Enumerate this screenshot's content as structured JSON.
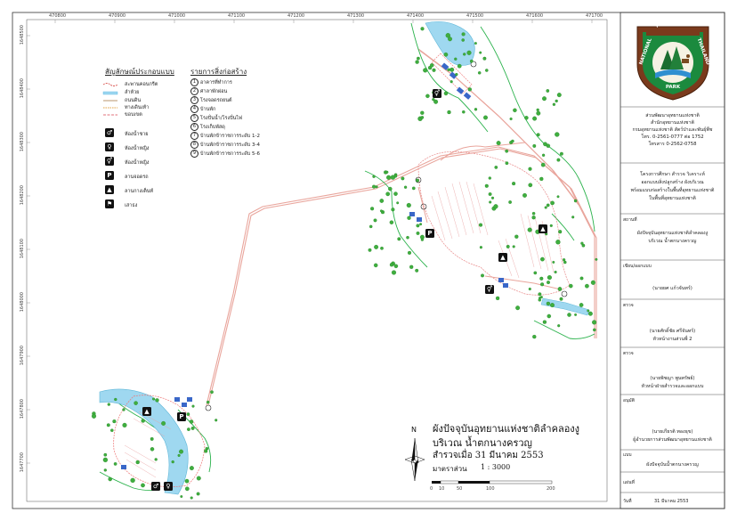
{
  "grid": {
    "top_ticks": [
      "470800",
      "470900",
      "471000",
      "471100",
      "471200",
      "471300",
      "471400",
      "471500",
      "471600",
      "471700"
    ],
    "left_ticks": [
      "1648500",
      "1648400",
      "1648300",
      "1648200",
      "1648100",
      "1648000",
      "1647900",
      "1647800",
      "1647700"
    ]
  },
  "legend": {
    "symbols_title": "สัญลักษณ์ประกอบแบบ",
    "lines": [
      {
        "label": "สะพานคอนกรีต",
        "color": "#d9534f"
      },
      {
        "label": "ลำห้วย",
        "color": "#4fb3e0"
      },
      {
        "label": "ถนนดิน",
        "color": "#b38b5d"
      },
      {
        "label": "ทางเดินเท้า",
        "color": "#e0a040"
      },
      {
        "label": "ขอบเขต",
        "color": "#e0707a"
      }
    ],
    "icons": [
      {
        "label": "ห้องน้ำชาย",
        "icon": "male-restroom-icon",
        "glyph": "♂"
      },
      {
        "label": "ห้องน้ำหญิง",
        "icon": "female-restroom-icon",
        "glyph": "♀"
      },
      {
        "label": "ห้องน้ำหญิง",
        "icon": "restroom-icon",
        "glyph": "⚥"
      },
      {
        "label": "ลานจอดรถ",
        "icon": "parking-icon",
        "glyph": "P"
      },
      {
        "label": "ลานกางเต็นท์",
        "icon": "camping-icon",
        "glyph": "▲"
      },
      {
        "label": "เสาธง",
        "icon": "flagpole-icon",
        "glyph": "⚑"
      }
    ],
    "facilities_title": "รายการสิ่งก่อสร้าง",
    "facilities": [
      {
        "num": "1",
        "label": "อาคารที่ทำการ"
      },
      {
        "num": "2",
        "label": "ศาลาพักผ่อน"
      },
      {
        "num": "3",
        "label": "โรงจอดรถยนต์"
      },
      {
        "num": "4",
        "label": "บ้านพัก"
      },
      {
        "num": "5",
        "label": "โรงปั่นน้ำ/โรงปั่นไฟ"
      },
      {
        "num": "6",
        "label": "โรงเก็บพัสดุ"
      },
      {
        "num": "7",
        "label": "บ้านพักข้าราชการระดับ 1-2"
      },
      {
        "num": "8",
        "label": "บ้านพักข้าราชการระดับ 3-4"
      },
      {
        "num": "9",
        "label": "บ้านพักข้าราชการระดับ 5-6"
      }
    ]
  },
  "plan": {
    "title": "ผังปัจจุบันอุทยานแห่งชาติลำคลองงู",
    "subtitle": "บริเวณ น้ำตกนางครวญ",
    "survey_date": "สำรวจเมื่อ 31 มีนาคม 2553",
    "scale_label": "มาตราส่วน",
    "scale_value": "1 : 3000",
    "north": "N",
    "scale_ticks": [
      "0",
      "10",
      "50",
      "100",
      "200"
    ]
  },
  "title_block": {
    "logo_top_text": "อุทยานแห่งชาติ",
    "logo_left_text": "NATIONAL",
    "logo_right_text": "THAILAND",
    "logo_bottom_text": "PARK",
    "org_lines": [
      "ส่วนพัฒนาอุทยานแห่งชาติ",
      "สำนักอุทยานแห่งชาติ",
      "กรมอุทยานแห่งชาติ สัตว์ป่าและพันธุ์พืช",
      "โทร. 0-2561-0777 ต่อ 1752",
      "โทรสาร 0-2562-0758"
    ],
    "project_lines": [
      "โครงการศึกษา สำรวจ วิเคราะห์",
      "ออกแบบสิ่งปลูกสร้าง ผังบริเวณ",
      "พร้อมแบบก่อสร้างในพื้นที่อุทยานแห่งชาติ",
      "ในพื้นที่อุทยานแห่งชาติ"
    ],
    "sheet_label": "สถานที่",
    "sheet_lines": [
      "ผังปัจจุบันอุทยานแห่งชาติลำคลองงู",
      "บริเวณ น้ำตกนางครวญ"
    ],
    "designer_label": "เขียน/ออกแบบ",
    "designer_name": "(นายยศ แก้วจันทร์)",
    "check1_label": "ตรวจ",
    "check1_name": "(นายศักดิ์ชัย ศรีจันทร์)",
    "check1_title": "หัวหน้างานส่วนพี่ 2",
    "check2_label": "ตรวจ",
    "check2_name": "(นายพิชญา พูนทรัพย์)",
    "check2_title": "หัวหน้าฝ่ายสำรวจและออกแบบ",
    "approve_label": "อนุมัติ",
    "approve_name": "(นายเกียรติ ทองธุข)",
    "approve_title": "ผู้อำนวยการส่วนพัฒนาอุทยานแห่งชาติ",
    "drawing_label": "แบบ",
    "drawing_name": "ผังปัจจุบันน้ำตกนางครวญ",
    "sheet_no_label": "แผ่นที่",
    "date_label": "วันที่",
    "date_value": "31 มีนาคม 2553"
  }
}
